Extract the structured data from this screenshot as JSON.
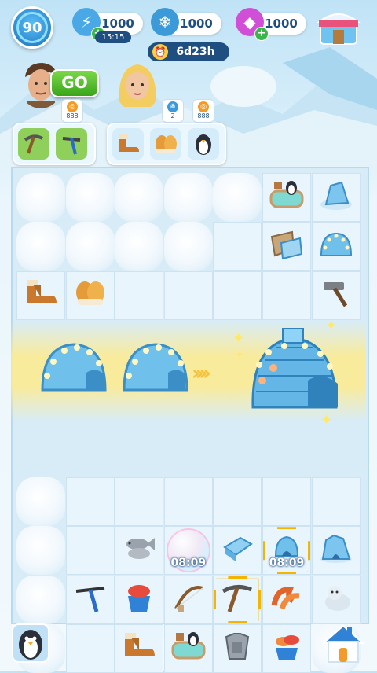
{
  "player": {
    "level": "90"
  },
  "resources": {
    "energy": {
      "value": "1000",
      "icon": "energy-bolt-icon",
      "timer": "15:15"
    },
    "snowflakes": {
      "value": "1000",
      "icon": "snowflake-icon"
    },
    "gems": {
      "value": "1000",
      "icon": "gem-icon"
    }
  },
  "event": {
    "timer": "6d23h"
  },
  "characters": {
    "go_label": "GO",
    "left_coin_count": "888",
    "right_snow_count": "2",
    "right_coin_count": "888"
  },
  "orders": {
    "left": [
      "pickaxe",
      "pickaxe"
    ],
    "right": [
      "boots",
      "mittens",
      "penguin"
    ]
  },
  "board": {
    "bubble_timer": "08:09",
    "selected_timer": "08:09"
  },
  "colors": {
    "accent": "#1f4e80",
    "go_green": "#3aa51a",
    "highlight": "#f5b400"
  }
}
